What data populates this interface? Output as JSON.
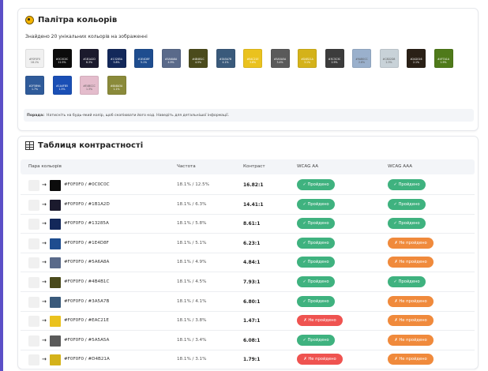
{
  "palette": {
    "title": "Палітра кольорів",
    "subtitle": "Знайдено 20 унікальних кольорів на зображенні",
    "colors": [
      {
        "hex": "#f0f0f0",
        "label": "#F0F0F0",
        "pct": "18.1%",
        "light": true
      },
      {
        "hex": "#0c0c0c",
        "label": "#0C0C0C",
        "pct": "12.5%"
      },
      {
        "hex": "#1b1a2d",
        "label": "#1B1A2D",
        "pct": "6.3%"
      },
      {
        "hex": "#13285a",
        "label": "#13285A",
        "pct": "5.8%"
      },
      {
        "hex": "#1e4d8f",
        "label": "#1E4D8F",
        "pct": "5.1%"
      },
      {
        "hex": "#5a6a8a",
        "label": "#5A6A8A",
        "pct": "4.9%"
      },
      {
        "hex": "#4b4b1c",
        "label": "#4B4B1C",
        "pct": "4.5%"
      },
      {
        "hex": "#3a5a7b",
        "label": "#3A5A7B",
        "pct": "4.1%"
      },
      {
        "hex": "#eac21e",
        "label": "#EAC21E",
        "pct": "3.8%"
      },
      {
        "hex": "#5a5a5a",
        "label": "#5A5A5A",
        "pct": "3.4%"
      },
      {
        "hex": "#d4b21a",
        "label": "#D4B21A",
        "pct": "3.1%"
      },
      {
        "hex": "#3c3c3c",
        "label": "#3C3C3C",
        "pct": "2.9%"
      },
      {
        "hex": "#9ab0cc",
        "label": "#9AB0CC",
        "pct": "2.6%",
        "light": true
      },
      {
        "hex": "#c8d2d8",
        "label": "#C8D2D8",
        "pct": "2.3%",
        "light": true
      },
      {
        "hex": "#2a2016",
        "label": "#2A2016",
        "pct": "2.1%"
      },
      {
        "hex": "#4f7a1a",
        "label": "#4F7A1A",
        "pct": "1.9%"
      },
      {
        "hex": "#2f5b9a",
        "label": "#2F5B9A",
        "pct": "1.7%"
      },
      {
        "hex": "#1a4fb5",
        "label": "#1A4FB5",
        "pct": "1.5%"
      },
      {
        "hex": "#e4bccc",
        "label": "#E4BCCC",
        "pct": "1.3%",
        "light": true
      },
      {
        "hex": "#8a8a3a",
        "label": "#8A8A3A",
        "pct": "1.1%"
      }
    ],
    "info_bold": "Порада:",
    "info_text": "Натисніть на будь-який колір, щоб скопіювати його код. Наведіть для детальнішої інформації."
  },
  "contrast": {
    "title": "Таблиця контрастності",
    "headers": {
      "pair": "Пара кольорів",
      "freq": "Частота",
      "ratio": "Контраст",
      "aa": "WCAG AA",
      "aaa": "WCAG AAA"
    },
    "rows": [
      {
        "bg": "#f0f0f0",
        "fg": "#0c0c0c",
        "pair": "#F0F0F0 / #0C0C0C",
        "freq": "18.1% / 12.5%",
        "ratio": "16.82:1",
        "aa": "✓ Пройдено",
        "aa_s": "pass",
        "aaa": "✓ Пройдено",
        "aaa_s": "pass"
      },
      {
        "bg": "#f0f0f0",
        "fg": "#1b1a2d",
        "pair": "#F0F0F0 / #1B1A2D",
        "freq": "18.1% / 6.3%",
        "ratio": "14.41:1",
        "aa": "✓ Пройдено",
        "aa_s": "pass",
        "aaa": "✓ Пройдено",
        "aaa_s": "pass"
      },
      {
        "bg": "#f0f0f0",
        "fg": "#13285a",
        "pair": "#F0F0F0 / #13285A",
        "freq": "18.1% / 5.8%",
        "ratio": "8.61:1",
        "aa": "✓ Пройдено",
        "aa_s": "pass",
        "aaa": "✓ Пройдено",
        "aaa_s": "pass"
      },
      {
        "bg": "#f0f0f0",
        "fg": "#1e4d8f",
        "pair": "#F0F0F0 / #1E4D8F",
        "freq": "18.1% / 5.1%",
        "ratio": "6.23:1",
        "aa": "✓ Пройдено",
        "aa_s": "pass",
        "aaa": "✗ Не пройдено",
        "aaa_s": "warn"
      },
      {
        "bg": "#f0f0f0",
        "fg": "#5a6a8a",
        "pair": "#F0F0F0 / #5A6A8A",
        "freq": "18.1% / 4.9%",
        "ratio": "4.84:1",
        "aa": "✓ Пройдено",
        "aa_s": "pass",
        "aaa": "✗ Не пройдено",
        "aaa_s": "warn"
      },
      {
        "bg": "#f0f0f0",
        "fg": "#4b4b1c",
        "pair": "#F0F0F0 / #4B4B1C",
        "freq": "18.1% / 4.5%",
        "ratio": "7.93:1",
        "aa": "✓ Пройдено",
        "aa_s": "pass",
        "aaa": "✓ Пройдено",
        "aaa_s": "pass"
      },
      {
        "bg": "#f0f0f0",
        "fg": "#3a5a7b",
        "pair": "#F0F0F0 / #3A5A7B",
        "freq": "18.1% / 4.1%",
        "ratio": "6.80:1",
        "aa": "✓ Пройдено",
        "aa_s": "pass",
        "aaa": "✗ Не пройдено",
        "aaa_s": "warn"
      },
      {
        "bg": "#f0f0f0",
        "fg": "#eac21e",
        "pair": "#F0F0F0 / #EAC21E",
        "freq": "18.1% / 3.8%",
        "ratio": "1.47:1",
        "aa": "✗ Не пройдено",
        "aa_s": "fail",
        "aaa": "✗ Не пройдено",
        "aaa_s": "warn"
      },
      {
        "bg": "#f0f0f0",
        "fg": "#5a5a5a",
        "pair": "#F0F0F0 / #5A5A5A",
        "freq": "18.1% / 3.4%",
        "ratio": "6.08:1",
        "aa": "✓ Пройдено",
        "aa_s": "pass",
        "aaa": "✗ Не пройдено",
        "aaa_s": "warn"
      },
      {
        "bg": "#f0f0f0",
        "fg": "#d4b21a",
        "pair": "#F0F0F0 / #D4B21A",
        "freq": "18.1% / 3.1%",
        "ratio": "1.79:1",
        "aa": "✗ Не пройдено",
        "aa_s": "fail",
        "aaa": "✗ Не пройдено",
        "aaa_s": "warn"
      }
    ]
  }
}
